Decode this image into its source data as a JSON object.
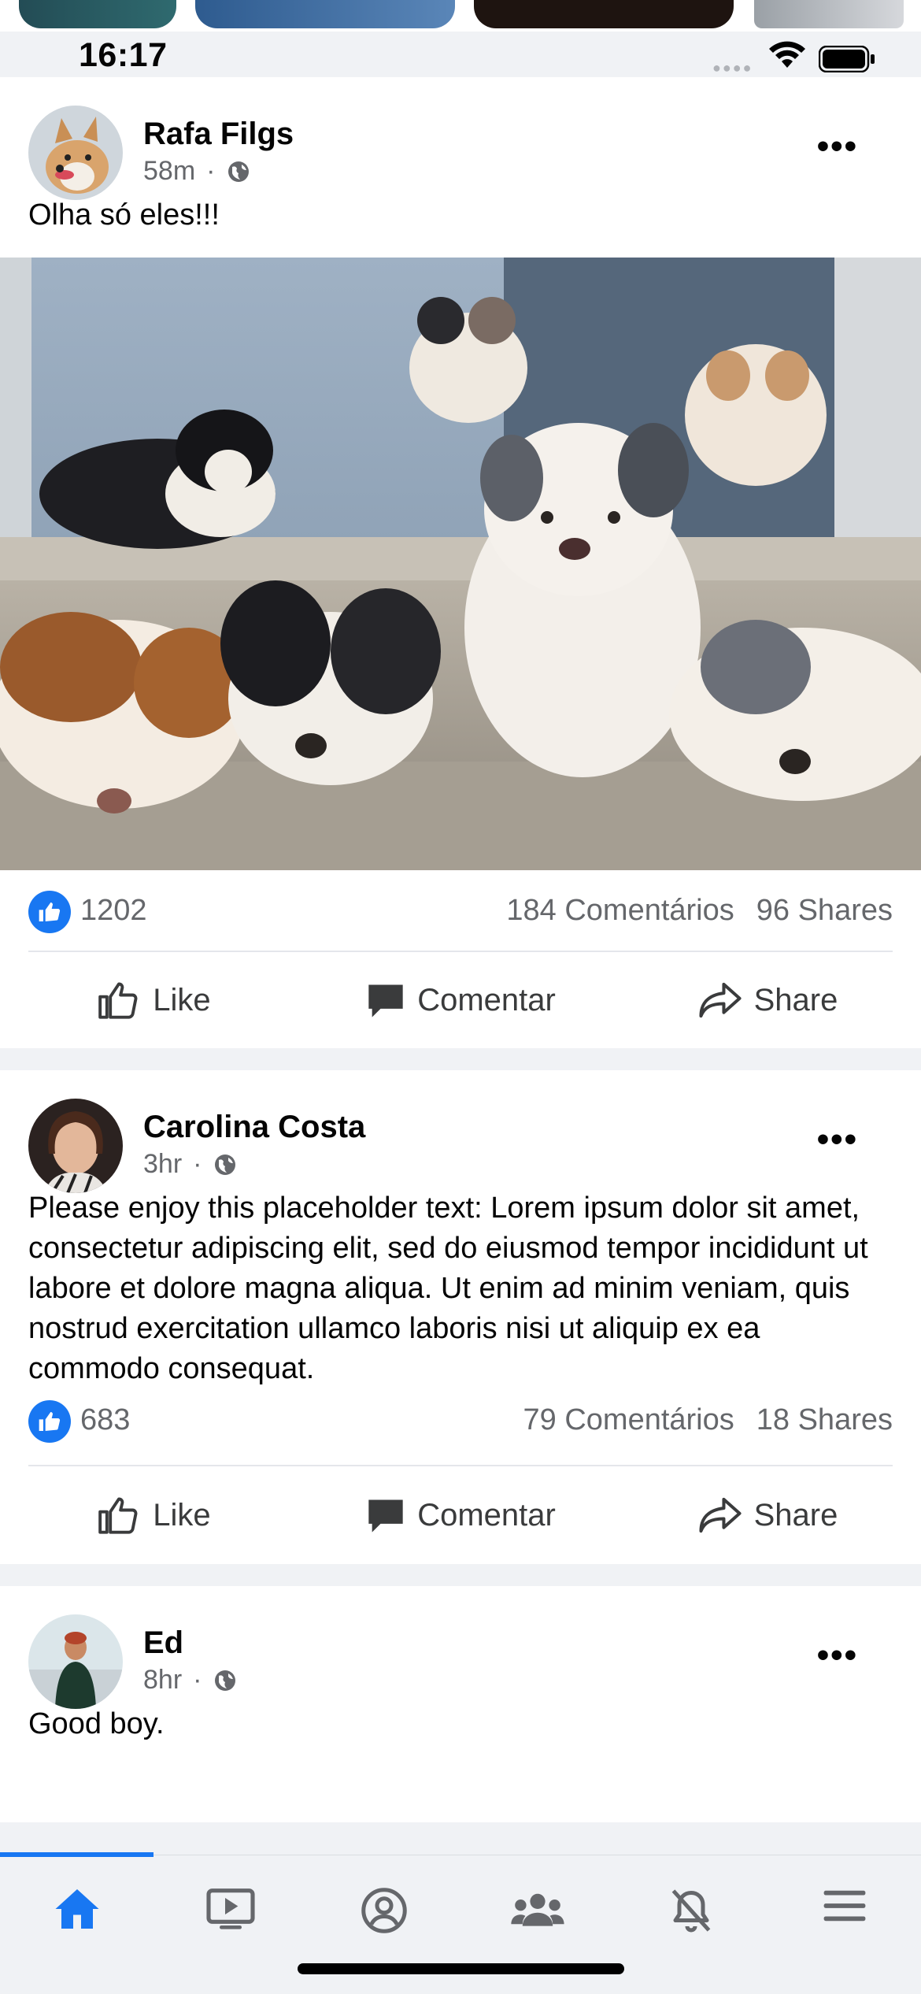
{
  "status_bar": {
    "time": "16:17"
  },
  "posts": [
    {
      "author": "Rafa Filgs",
      "time": "58m",
      "separator": "·",
      "text": "Olha só eles!!!",
      "has_photo": true,
      "likes": "1202",
      "comments": "184 Comentários",
      "shares": "96 Shares"
    },
    {
      "author": "Carolina Costa",
      "time": "3hr",
      "separator": "·",
      "text": "Please enjoy this placeholder text: Lorem ipsum dolor sit amet, consectetur adipiscing elit, sed do eiusmod tempor incididunt ut labore et dolore magna aliqua. Ut enim ad minim veniam, quis nostrud exercitation ullamco laboris nisi ut aliquip ex ea commodo consequat.",
      "has_photo": false,
      "likes": "683",
      "comments": "79 Comentários",
      "shares": "18 Shares"
    },
    {
      "author": "Ed",
      "time": "8hr",
      "separator": "·",
      "text": "Good boy."
    }
  ],
  "actions": {
    "like": "Like",
    "comment": "Comentar",
    "share": "Share"
  },
  "more_label": "•••",
  "tabbar": {
    "active_tab": "home",
    "tabs": [
      "home-icon",
      "watch-icon",
      "profile-icon",
      "groups-icon",
      "notifications-off-icon",
      "menu-icon"
    ]
  },
  "colors": {
    "accent": "#1877f2",
    "background": "#f0f2f5",
    "muted_text": "#65676b"
  }
}
